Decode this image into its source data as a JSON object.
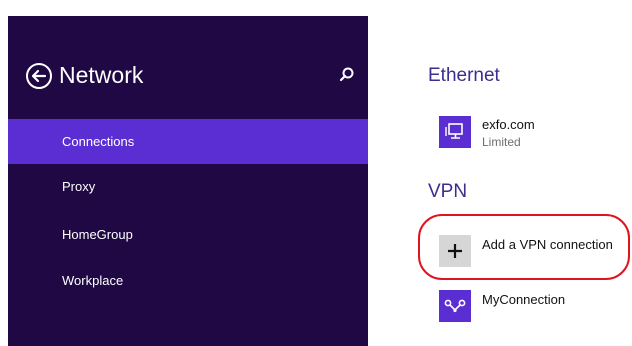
{
  "sidebar": {
    "title": "Network",
    "back_icon": "back-arrow-circle-icon",
    "search_icon": "search-icon",
    "items": [
      {
        "label": "Connections",
        "selected": true
      },
      {
        "label": "Proxy",
        "selected": false
      },
      {
        "label": "HomeGroup",
        "selected": false
      },
      {
        "label": "Workplace",
        "selected": false
      }
    ]
  },
  "main": {
    "ethernet": {
      "heading": "Ethernet",
      "connection": {
        "name": "exfo.com",
        "status": "Limited",
        "icon": "network-icon"
      }
    },
    "vpn": {
      "heading": "VPN",
      "add_label": "Add a VPN connection",
      "add_icon": "plus-icon",
      "connection": {
        "name": "MyConnection",
        "icon": "vpn-icon"
      }
    }
  },
  "colors": {
    "sidebar_bg": "#1f0844",
    "accent": "#5a2ed3",
    "heading": "#3f2c8f",
    "highlight": "#e0141e"
  }
}
